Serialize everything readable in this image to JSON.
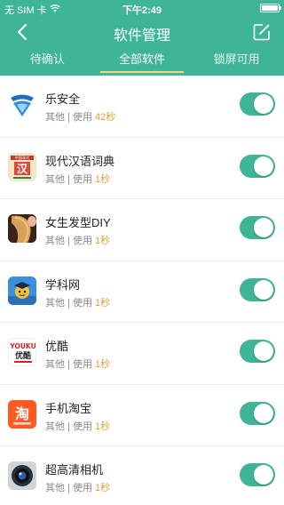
{
  "status_bar": {
    "carrier": "无 SIM 卡",
    "time": "下午2:49",
    "battery_level": 1.0
  },
  "nav": {
    "title": "软件管理",
    "back_icon": "chevron-left-icon",
    "edit_icon": "edit-icon"
  },
  "tabs": [
    {
      "label": "待确认",
      "active": false
    },
    {
      "label": "全部软件",
      "active": true
    },
    {
      "label": "锁屏可用",
      "active": false
    }
  ],
  "apps": [
    {
      "name": "乐安全",
      "category": "其他",
      "usage_label": "使用",
      "duration": "42秒",
      "enabled": true,
      "icon": "shield-app-icon"
    },
    {
      "name": "现代汉语词典",
      "category": "其他",
      "usage_label": "使用",
      "duration": "1秒",
      "enabled": true,
      "icon": "dictionary-app-icon"
    },
    {
      "name": "女生发型DIY",
      "category": "其他",
      "usage_label": "使用",
      "duration": "1秒",
      "enabled": true,
      "icon": "hairstyle-app-icon"
    },
    {
      "name": "学科网",
      "category": "其他",
      "usage_label": "使用",
      "duration": "1秒",
      "enabled": true,
      "icon": "xueke-app-icon"
    },
    {
      "name": "优酷",
      "category": "其他",
      "usage_label": "使用",
      "duration": "1秒",
      "enabled": true,
      "icon": "youku-app-icon"
    },
    {
      "name": "手机淘宝",
      "category": "其他",
      "usage_label": "使用",
      "duration": "1秒",
      "enabled": true,
      "icon": "taobao-app-icon"
    },
    {
      "name": "超高清相机",
      "category": "其他",
      "usage_label": "使用",
      "duration": "1秒",
      "enabled": true,
      "icon": "camera-app-icon"
    }
  ],
  "icon_text": {
    "dictionary_top": "中国现代",
    "dictionary_big": "汉",
    "youku_top": "YOUKU",
    "youku_mid": "优酷",
    "taobao_big": "淘"
  },
  "colors": {
    "accent": "#3fb598",
    "duration": "#e3a03c",
    "tab_underline": "#f7d77a"
  }
}
